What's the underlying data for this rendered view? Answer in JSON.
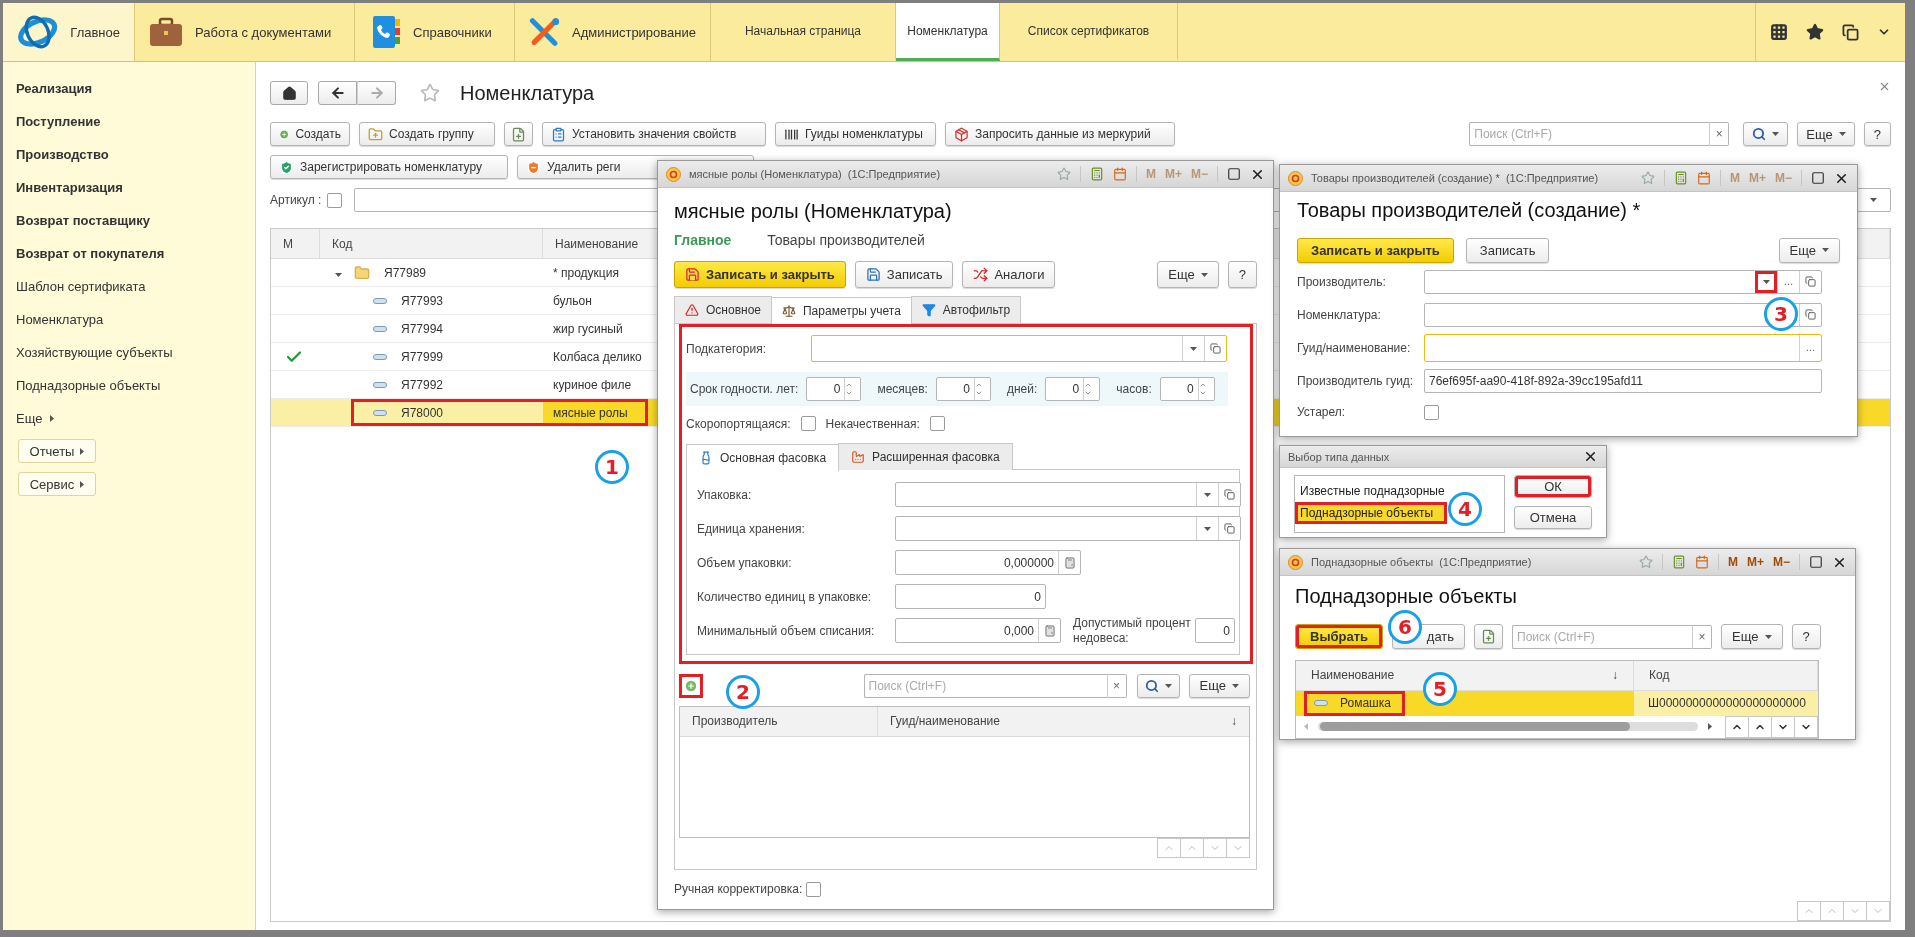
{
  "top_bar": {
    "sections": [
      {
        "label": "Главное",
        "selected": true
      },
      {
        "label": "Работа с документами",
        "selected": false
      },
      {
        "label": "Справочники",
        "selected": false
      },
      {
        "label": "Администрирование",
        "selected": false
      }
    ],
    "tabs": [
      {
        "label": "Начальная страница",
        "selected": false
      },
      {
        "label": "Номенклатура",
        "selected": true
      },
      {
        "label": "Список сертификатов",
        "selected": false
      }
    ]
  },
  "sidebar": {
    "items": [
      {
        "label": "Реализация",
        "kind": "section"
      },
      {
        "label": "Поступление",
        "kind": "section"
      },
      {
        "label": "Производство",
        "kind": "section"
      },
      {
        "label": "Инвентаризация",
        "kind": "section"
      },
      {
        "label": "Возврат поставщику",
        "kind": "section"
      },
      {
        "label": "Возврат от покупателя",
        "kind": "section"
      },
      {
        "label": "Шаблон сертификата",
        "kind": "link"
      },
      {
        "label": "Номенклатура",
        "kind": "link"
      },
      {
        "label": "Хозяйствующие субъекты",
        "kind": "link"
      },
      {
        "label": "Поднадзорные объекты",
        "kind": "link"
      },
      {
        "label": "Еще",
        "kind": "more"
      },
      {
        "label": "Отчеты",
        "kind": "button"
      },
      {
        "label": "Сервис",
        "kind": "button"
      }
    ]
  },
  "list_form": {
    "title": "Номенклатура",
    "toolbar_rows": [
      [
        {
          "label": "Создать"
        },
        {
          "label": "Создать группу"
        },
        {},
        {
          "label": "Установить значения свойств"
        },
        {
          "label": "Гуиды номенклатуры"
        },
        {
          "label": "Запросить данные из меркурий"
        }
      ],
      [
        {
          "label": "Зарегистрировать номенклатуру"
        },
        {
          "label": "Удалить реги"
        }
      ]
    ],
    "search": {
      "placeholder": "Поиск (Ctrl+F)"
    },
    "clear": "×",
    "more": "Еще",
    "help": "?",
    "filter": {
      "label": "Артикул :",
      "checked": false
    },
    "columns": [
      "М",
      "Код",
      "Наименование"
    ],
    "rows": [
      {
        "marked": false,
        "code": "Я77989",
        "name": "* продукция",
        "kind": "group",
        "expanded": true,
        "selected": false,
        "highlighted": false
      },
      {
        "marked": false,
        "code": "Я77993",
        "name": "бульон",
        "kind": "item",
        "selected": false,
        "highlighted": false
      },
      {
        "marked": false,
        "code": "Я77994",
        "name": "жир гусиный",
        "kind": "item",
        "selected": false,
        "highlighted": false
      },
      {
        "marked": true,
        "code": "Я77999",
        "name": "Колбаса делико",
        "kind": "item",
        "selected": false,
        "highlighted": false
      },
      {
        "marked": false,
        "code": "Я77992",
        "name": "куриное филе",
        "kind": "item",
        "selected": false,
        "highlighted": false
      },
      {
        "marked": false,
        "code": "Я78000",
        "name": "мясные ролы",
        "kind": "item",
        "selected": true,
        "highlighted": true,
        "callout": "1"
      }
    ]
  },
  "product_form": {
    "window_title": "мясные ролы (Номенклатура)  (1С:Предприятие)",
    "memory_buttons": [
      {
        "label": "M",
        "disabled": true
      },
      {
        "label": "M+",
        "disabled": true
      },
      {
        "label": "M−",
        "disabled": true
      }
    ],
    "heading": "мясные ролы (Номенклатура)",
    "sections": [
      {
        "label": "Главное",
        "selected": true
      },
      {
        "label": "Товары производителей",
        "selected": false
      }
    ],
    "toolbar": [
      {
        "label": "Записать и закрыть",
        "kind": "primary"
      },
      {
        "label": "Записать",
        "kind": "normal"
      },
      {
        "label": "Аналоги",
        "kind": "normal"
      }
    ],
    "more": "Еще",
    "help": "?",
    "tabs": [
      {
        "label": "Основное",
        "selected": false
      },
      {
        "label": "Параметры учета",
        "selected": true
      },
      {
        "label": "Автофильтр",
        "selected": false
      }
    ],
    "params": {
      "highlighted": true,
      "subcategory": {
        "label": "Подкатегория:",
        "focused": true
      },
      "shelf_life": [
        {
          "label": "Срок годности. лет:",
          "value": "0"
        },
        {
          "label": "месяцев:",
          "value": "0"
        },
        {
          "label": "дней:",
          "value": "0"
        },
        {
          "label": "часов:",
          "value": "0"
        }
      ],
      "flags": [
        {
          "label": "Скоропортящаяся:",
          "checked": false
        },
        {
          "label": "Некачественная:",
          "checked": false
        }
      ],
      "subtabs": [
        {
          "label": "Основная фасовка",
          "selected": true
        },
        {
          "label": "Расширенная фасовка",
          "selected": false
        }
      ],
      "packing": [
        {
          "label": "Упаковка:",
          "kind": "select"
        },
        {
          "label": "Единица хранения:",
          "kind": "select"
        },
        {
          "label": "Объем упаковки:",
          "kind": "number",
          "value": "0,000000"
        },
        {
          "label": "Количество единиц в упаковке:",
          "kind": "integer",
          "value": "0"
        },
        {
          "label": "Минимальный объем списания:",
          "kind": "number",
          "value": "0,000",
          "extra": {
            "label": "Допустимый процент недовеса:",
            "value": "0"
          }
        }
      ]
    },
    "producers": {
      "add": {
        "highlighted": true,
        "callout": "2"
      },
      "search": {
        "placeholder": "Поиск (Ctrl+F)"
      },
      "clear": "×",
      "more": "Еще",
      "columns": [
        "Производитель",
        "Гуид/наименование"
      ],
      "sort": "↓"
    },
    "manual": {
      "label": "Ручная корректировка:",
      "checked": false
    }
  },
  "producer_goods_form": {
    "window_title": "Товары производителей (создание) *  (1С:Предприятие)",
    "memory_buttons": [
      {
        "label": "M",
        "disabled": true
      },
      {
        "label": "M+",
        "disabled": true
      },
      {
        "label": "M−",
        "disabled": true
      }
    ],
    "heading": "Товары производителей (создание) *",
    "toolbar": [
      {
        "label": "Записать и закрыть",
        "kind": "primary"
      },
      {
        "label": "Записать",
        "kind": "normal"
      }
    ],
    "more": "Еще",
    "fields": [
      {
        "label": "Производитель:",
        "kind": "select",
        "focused": false,
        "dropdown_highlighted": true,
        "choose": "…",
        "callout": "3"
      },
      {
        "label": "Номенклатура:",
        "kind": "open",
        "focused": false
      },
      {
        "label": "Гуид/наименование:",
        "kind": "choice",
        "focused": true,
        "choose": "…"
      },
      {
        "label": "Производитель гуид:",
        "kind": "text",
        "focused": false,
        "value": "76ef695f-aa90-418f-892a-39cc195afd11"
      }
    ],
    "obsolete": {
      "label": "Устарел:",
      "checked": false
    }
  },
  "type_choice": {
    "title": "Выбор типа данных",
    "items": [
      {
        "label": "Известные поднадзорные",
        "selected": false,
        "highlighted": false
      },
      {
        "label": "Поднадзорные объекты",
        "selected": true,
        "highlighted": true,
        "callout": "4"
      }
    ],
    "buttons": [
      {
        "label": "ОК",
        "highlighted": true
      },
      {
        "label": "Отмена",
        "highlighted": false
      }
    ]
  },
  "objects_choice": {
    "window_title": "Поднадзорные объекты  (1С:Предприятие)",
    "memory_buttons": [
      {
        "label": "M",
        "disabled": false
      },
      {
        "label": "M+",
        "disabled": false
      },
      {
        "label": "M−",
        "disabled": false
      }
    ],
    "heading": "Поднадзорные объекты",
    "select_button": {
      "label": "Выбрать",
      "highlighted": true,
      "callout": "6"
    },
    "create_button": {
      "label": "дать"
    },
    "search": {
      "placeholder": "Поиск (Ctrl+F)"
    },
    "clear": "×",
    "more": "Еще",
    "help": "?",
    "columns": [
      {
        "label": "Наименование",
        "sort": "↓"
      },
      {
        "label": "Код"
      }
    ],
    "rows": [
      {
        "name": "Ромашка",
        "code": "Ш0000000000000000000000",
        "selected": true,
        "highlighted": true,
        "callout": "5"
      }
    ]
  }
}
